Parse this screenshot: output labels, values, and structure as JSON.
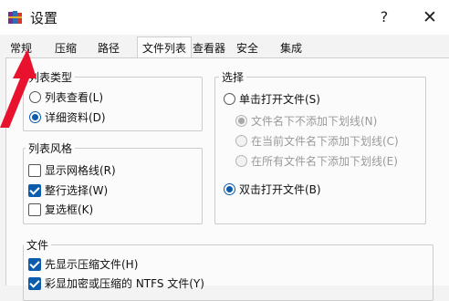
{
  "window": {
    "title": "设置",
    "help_label": "?",
    "close_label": "✕"
  },
  "tabs": [
    "常规",
    "压缩",
    "路径",
    "文件列表",
    "查看器",
    "安全",
    "集成"
  ],
  "active_tab": "文件列表",
  "list_type": {
    "legend": "列表类型",
    "options": [
      {
        "label": "列表查看(L)",
        "checked": false
      },
      {
        "label": "详细资料(D)",
        "checked": true
      }
    ]
  },
  "select": {
    "legend": "选择",
    "single_click": "单击打开文件(S)",
    "sub_options": [
      "文件名下不添加下划线(N)",
      "在当前文件名下添加下划线(C)",
      "在所有文件名下添加下划线(E)"
    ],
    "double_click": "双击打开文件(B)"
  },
  "list_style": {
    "legend": "列表风格",
    "options": [
      {
        "label": "显示网格线(R)",
        "checked": false
      },
      {
        "label": "整行选择(W)",
        "checked": true
      },
      {
        "label": "复选框(K)",
        "checked": false
      }
    ]
  },
  "files": {
    "legend": "文件",
    "options": [
      {
        "label": "先显示压缩文件(H)",
        "checked": true
      },
      {
        "label": "彩显加密或压缩的 NTFS 文件(Y)",
        "checked": true
      }
    ]
  },
  "colors": {
    "accent": "#0b5cad",
    "arrow": "#e8122f"
  },
  "icons": {
    "app": "winrar-books-icon",
    "arrow": "red-arrow-annotation"
  }
}
